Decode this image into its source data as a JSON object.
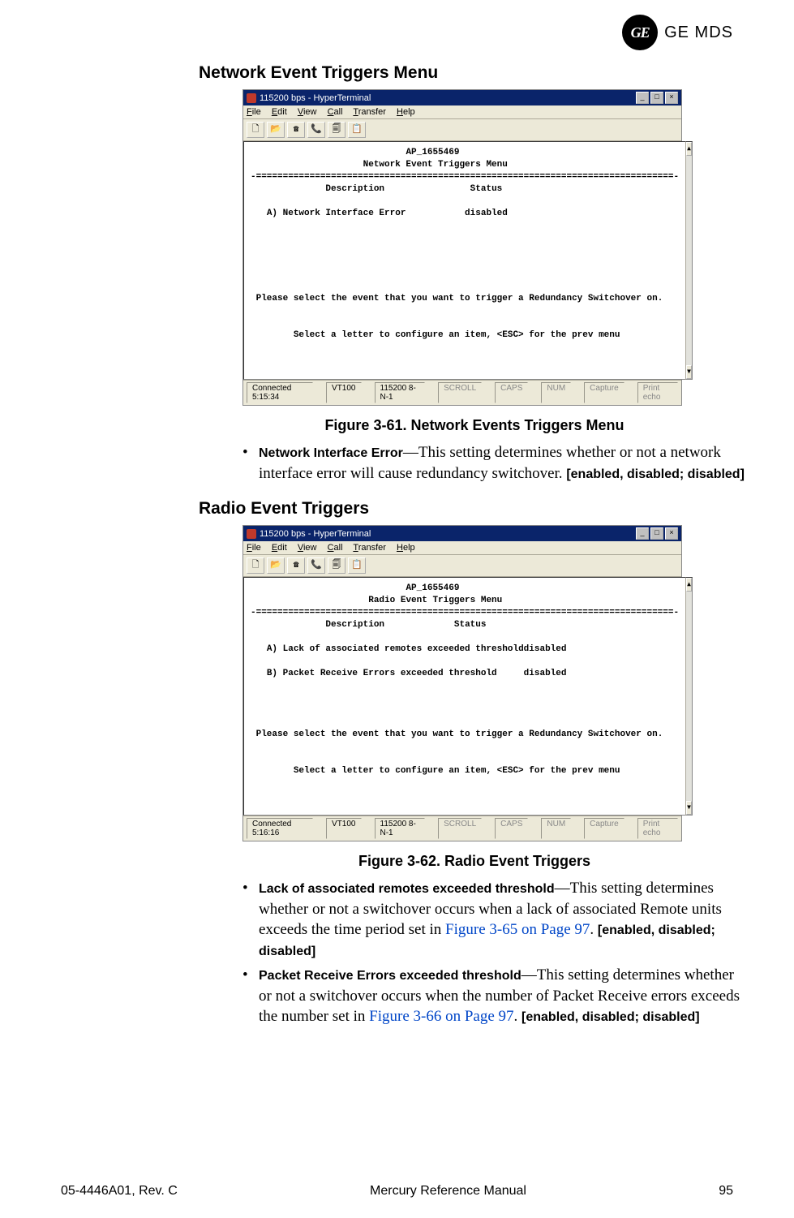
{
  "header": {
    "logo_monogram": "GE",
    "logo_text": "GE MDS"
  },
  "section1": {
    "title": "Network Event Triggers Menu",
    "caption": "Figure 3-61. Network Events Triggers Menu"
  },
  "section2": {
    "title": "Radio Event Triggers",
    "caption": "Figure 3-62. Radio Event Triggers"
  },
  "terminal_common": {
    "title": "115200 bps - HyperTerminal",
    "menu_file": "File",
    "menu_edit": "Edit",
    "menu_view": "View",
    "menu_call": "Call",
    "menu_transfer": "Transfer",
    "menu_help": "Help",
    "ap_id": "AP_1655469",
    "divider": "-==============================================================================-",
    "col_desc": "Description",
    "col_status": "Status",
    "prompt1": "Please select the event that you want to trigger a Redundancy Switchover on.",
    "prompt2": "Select a letter to configure an item, <ESC> for the prev menu",
    "status_term": "VT100",
    "status_conn": "115200 8-N-1",
    "status_scroll": "SCROLL",
    "status_caps": "CAPS",
    "status_num": "NUM",
    "status_capture": "Capture",
    "status_echo": "Print echo"
  },
  "terminal1": {
    "menu_title": "Network Event Triggers Menu",
    "row_a": "A) Network Interface Error           disabled",
    "connected": "Connected 5:15:34"
  },
  "terminal2": {
    "menu_title": "Radio Event Triggers Menu",
    "row_a": "A) Lack of associated remotes exceeded thresholddisabled",
    "row_b": "B) Packet Receive Errors exceeded threshold     disabled",
    "connected": "Connected 5:16:16"
  },
  "bullets": {
    "b1_label": "Network Interface Error",
    "b1_text": "—This setting determines whether or not a network interface error will cause redundancy switchover. ",
    "b1_opts": "[enabled, disabled; disabled]",
    "b2_label": "Lack of associated remotes exceeded threshold",
    "b2_text1": "—This setting determines whether or not a switchover occurs when a lack of associated Remote units exceeds the time period set in ",
    "b2_xref": "Figure 3-65 on Page 97",
    "b2_text2": ". ",
    "b2_opts": "[enabled, disabled; disabled]",
    "b3_label": "Packet Receive Errors exceeded threshold",
    "b3_text1": "—This setting determines whether or not a switchover occurs when the number of Packet Receive errors exceeds the number set in ",
    "b3_xref": "Figure 3-66 on Page 97",
    "b3_text2": ". ",
    "b3_opts": "[enabled, disabled; disabled]"
  },
  "footer": {
    "left": "05-4446A01, Rev. C",
    "center": "Mercury Reference Manual",
    "right": "95"
  }
}
